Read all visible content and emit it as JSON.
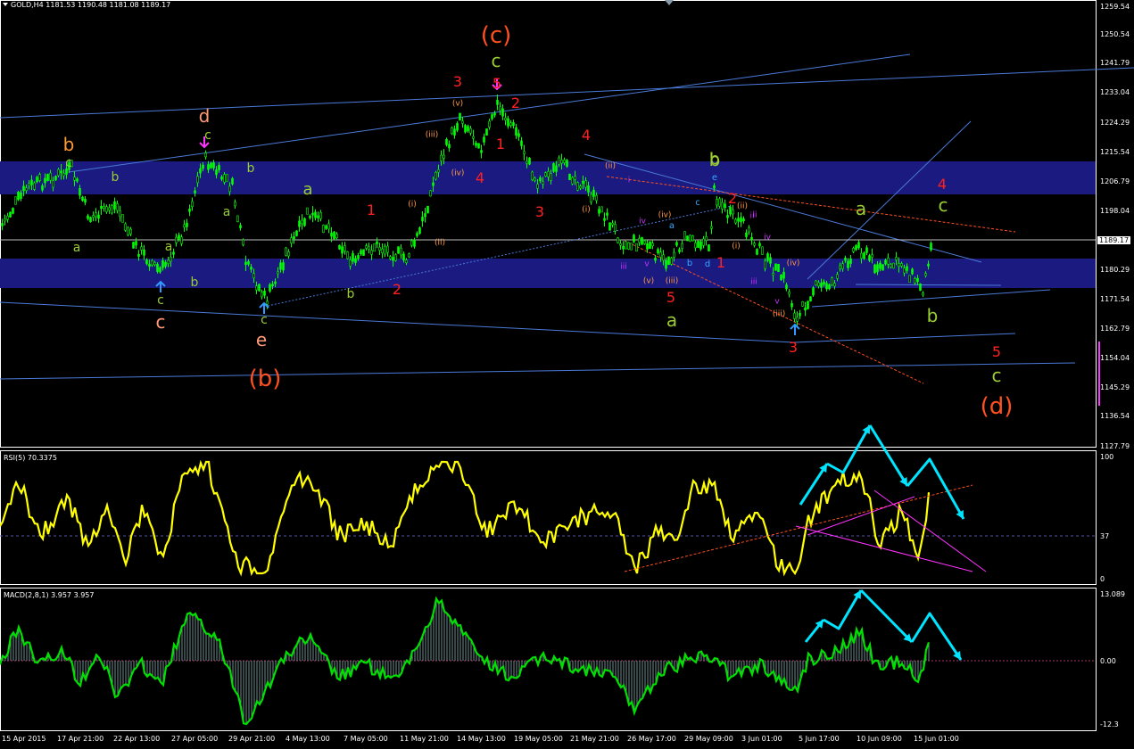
{
  "symbol_header": "GOLD,H4  1181.53 1190.48 1181.08 1189.17",
  "current_price": "1189.17",
  "price_scale": [
    "1259.54",
    "1250.54",
    "1241.79",
    "1233.04",
    "1224.29",
    "1215.54",
    "1206.79",
    "1198.04",
    "1180.29",
    "1171.54",
    "1162.79",
    "1154.04",
    "1145.29",
    "1136.54",
    "1127.79"
  ],
  "rsi": {
    "label": "RSI(5) 70.3375",
    "scale": [
      "100",
      "37",
      "0"
    ]
  },
  "macd": {
    "label": "MACD(2,8,1) 3.957 3.957",
    "scale": [
      "13.089",
      "0.00",
      "-12.3"
    ]
  },
  "time_axis": [
    "15 Apr 2015",
    "17 Apr 21:00",
    "22 Apr 13:00",
    "27 Apr 05:00",
    "29 Apr 21:00",
    "4 May 13:00",
    "7 May 05:00",
    "11 May 21:00",
    "14 May 13:00",
    "19 May 05:00",
    "21 May 21:00",
    "26 May 17:00",
    "29 May 09:00",
    "3 Jun 01:00",
    "5 Jun 17:00",
    "10 Jun 09:00",
    "15 Jun 01:00"
  ],
  "colors": {
    "background": "#000000",
    "zone": "#1a1a80",
    "candle": "#00ff00",
    "rsi": "#ffff00",
    "macd": "#00e000",
    "arrows": "#00e5ff",
    "trend": "#4a7ad8",
    "red": "#ff2020",
    "orange": "#ff5020"
  },
  "wave_labels": [
    {
      "t": "(c)",
      "c": "#ff5020",
      "s": 26
    },
    {
      "t": "c",
      "c": "#9acd32",
      "s": 20
    },
    {
      "t": "3",
      "c": "#ff2020",
      "s": 16
    },
    {
      "t": "5",
      "c": "#ff2020",
      "s": 16
    },
    {
      "t": "2",
      "c": "#ff2020",
      "s": 16
    },
    {
      "t": "1",
      "c": "#ff2020",
      "s": 16
    },
    {
      "t": "4",
      "c": "#ff2020",
      "s": 16
    },
    {
      "t": "4",
      "c": "#ff2020",
      "s": 16
    },
    {
      "t": "3",
      "c": "#ff2020",
      "s": 16
    },
    {
      "t": "d",
      "c": "#ff9977",
      "s": 20
    },
    {
      "t": "c",
      "c": "#9acd32",
      "s": 14
    },
    {
      "t": "b",
      "c": "#ff9933",
      "s": 20
    },
    {
      "t": "c",
      "c": "#9acd32",
      "s": 14
    },
    {
      "t": "b",
      "c": "#9acd32",
      "s": 14
    },
    {
      "t": "b",
      "c": "#9acd32",
      "s": 14
    },
    {
      "t": "a",
      "c": "#9acd32",
      "s": 18
    },
    {
      "t": "a",
      "c": "#9acd32",
      "s": 14
    },
    {
      "t": "a",
      "c": "#9acd32",
      "s": 14
    },
    {
      "t": "a",
      "c": "#9acd32",
      "s": 14
    },
    {
      "t": "b",
      "c": "#9acd32",
      "s": 14
    },
    {
      "t": "b",
      "c": "#9acd32",
      "s": 14
    },
    {
      "t": "c",
      "c": "#9acd32",
      "s": 14
    },
    {
      "t": "c",
      "c": "#ff9977",
      "s": 20
    },
    {
      "t": "e",
      "c": "#ff9977",
      "s": 20
    },
    {
      "t": "c",
      "c": "#9acd32",
      "s": 14
    },
    {
      "t": "(b)",
      "c": "#ff5020",
      "s": 26
    },
    {
      "t": "b",
      "c": "#9acd32",
      "s": 18
    },
    {
      "t": "1",
      "c": "#ff2020",
      "s": 16
    },
    {
      "t": "2",
      "c": "#ff2020",
      "s": 16
    },
    {
      "t": "b",
      "c": "#9acd32",
      "s": 20
    },
    {
      "t": "e",
      "c": "#33aaff",
      "s": 10
    },
    {
      "t": "c",
      "c": "#33aaff",
      "s": 10
    },
    {
      "t": "a",
      "c": "#33aaff",
      "s": 10
    },
    {
      "t": "b",
      "c": "#33aaff",
      "s": 10
    },
    {
      "t": "d",
      "c": "#33aaff",
      "s": 10
    },
    {
      "t": "2",
      "c": "#ff2020",
      "s": 16
    },
    {
      "t": "1",
      "c": "#ff2020",
      "s": 16
    },
    {
      "t": "5",
      "c": "#ff2020",
      "s": 16
    },
    {
      "t": "a",
      "c": "#9acd32",
      "s": 20
    },
    {
      "t": "a",
      "c": "#9acd32",
      "s": 20
    },
    {
      "t": "c",
      "c": "#9acd32",
      "s": 20
    },
    {
      "t": "4",
      "c": "#ff2020",
      "s": 16
    },
    {
      "t": "b",
      "c": "#9acd32",
      "s": 20
    },
    {
      "t": "3",
      "c": "#ff2020",
      "s": 16
    },
    {
      "t": "5",
      "c": "#ff2020",
      "s": 16
    },
    {
      "t": "c",
      "c": "#9acd32",
      "s": 20
    },
    {
      "t": "(d)",
      "c": "#ff5020",
      "s": 26
    },
    {
      "t": "(v)",
      "c": "#ff9944",
      "s": 9
    },
    {
      "t": "(iii)",
      "c": "#ff9944",
      "s": 9
    },
    {
      "t": "(iv)",
      "c": "#ff9944",
      "s": 9
    },
    {
      "t": "(i)",
      "c": "#ff9944",
      "s": 9
    },
    {
      "t": "(ii)",
      "c": "#ff9944",
      "s": 9
    },
    {
      "t": "(ii)",
      "c": "#ff9944",
      "s": 9
    },
    {
      "t": "(i)",
      "c": "#ff9944",
      "s": 9
    },
    {
      "t": "(iv)",
      "c": "#ff9944",
      "s": 9
    },
    {
      "t": "(iii)",
      "c": "#ff9944",
      "s": 9
    },
    {
      "t": "(v)",
      "c": "#ff9944",
      "s": 9
    },
    {
      "t": "(ii)",
      "c": "#ff9944",
      "s": 9
    },
    {
      "t": "(i)",
      "c": "#ff9944",
      "s": 9
    },
    {
      "t": "(iv)",
      "c": "#ff9944",
      "s": 9
    },
    {
      "t": "(iii)",
      "c": "#ff9944",
      "s": 9
    },
    {
      "t": "i",
      "c": "#cc33ff",
      "s": 9
    },
    {
      "t": "ii",
      "c": "#cc33ff",
      "s": 9
    },
    {
      "t": "iv",
      "c": "#cc33ff",
      "s": 9
    },
    {
      "t": "iii",
      "c": "#cc33ff",
      "s": 9
    },
    {
      "t": "v",
      "c": "#cc33ff",
      "s": 9
    },
    {
      "t": "ii",
      "c": "#cc33ff",
      "s": 9
    },
    {
      "t": "iv",
      "c": "#cc33ff",
      "s": 9
    },
    {
      "t": "iii",
      "c": "#cc33ff",
      "s": 9
    },
    {
      "t": "v",
      "c": "#cc33ff",
      "s": 9
    }
  ]
}
